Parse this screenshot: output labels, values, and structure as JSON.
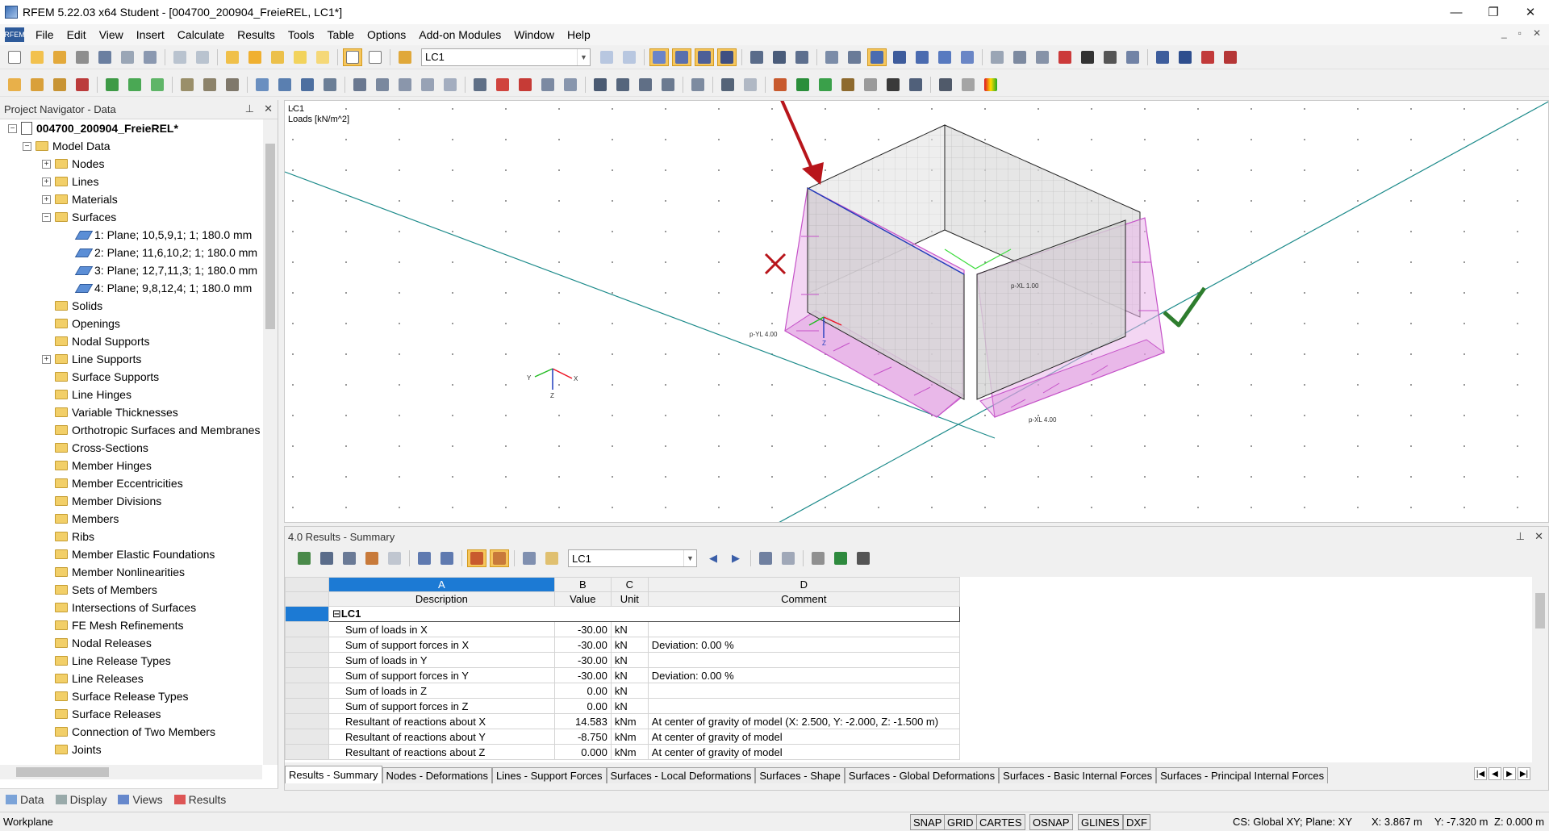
{
  "window": {
    "title": "RFEM 5.22.03 x64 Student - [004700_200904_FreieREL, LC1*]",
    "controls": [
      "—",
      "❐",
      "✕"
    ]
  },
  "menu": {
    "logo": "RFEM",
    "items": [
      "File",
      "Edit",
      "View",
      "Insert",
      "Calculate",
      "Results",
      "Tools",
      "Table",
      "Options",
      "Add-on Modules",
      "Window",
      "Help"
    ],
    "mdi_controls": [
      "_",
      "▫",
      "✕"
    ]
  },
  "toolbar": {
    "load_case": "LC1"
  },
  "navigator": {
    "title": "Project Navigator - Data",
    "project": "004700_200904_FreieREL*",
    "model_data": "Model Data",
    "items": {
      "nodes": "Nodes",
      "lines": "Lines",
      "materials": "Materials",
      "surfaces": "Surfaces",
      "surface_1": "1: Plane; 10,5,9,1; 1; 180.0 mm",
      "surface_2": "2: Plane; 11,6,10,2; 1; 180.0 mm",
      "surface_3": "3: Plane; 12,7,11,3; 1; 180.0 mm",
      "surface_4": "4: Plane; 9,8,12,4; 1; 180.0 mm",
      "solids": "Solids",
      "openings": "Openings",
      "nodal_supports": "Nodal Supports",
      "line_supports": "Line Supports",
      "surface_supports": "Surface Supports",
      "line_hinges": "Line Hinges",
      "variable_thicknesses": "Variable Thicknesses",
      "orthotropic": "Orthotropic Surfaces and Membranes",
      "cross_sections": "Cross-Sections",
      "member_hinges": "Member Hinges",
      "member_eccentricities": "Member Eccentricities",
      "member_divisions": "Member Divisions",
      "members": "Members",
      "ribs": "Ribs",
      "member_elastic_foundations": "Member Elastic Foundations",
      "member_nonlinearities": "Member Nonlinearities",
      "sets_of_members": "Sets of Members",
      "intersections": "Intersections of Surfaces",
      "fe_mesh": "FE Mesh Refinements",
      "nodal_releases": "Nodal Releases",
      "line_release_types": "Line Release Types",
      "line_releases": "Line Releases",
      "surface_release_types": "Surface Release Types",
      "surface_releases": "Surface Releases",
      "connection_two_members": "Connection of Two Members",
      "joints": "Joints"
    },
    "tabs": [
      "Data",
      "Display",
      "Views",
      "Results"
    ]
  },
  "view": {
    "lc": "LC1",
    "loads_label": "Loads [kN/m^2]",
    "load_labels": {
      "pyl": "p-YL 4.00",
      "pxl_top": "p-XL 1.00",
      "pxl_bottom": "p-XL 4.00"
    },
    "axes": {
      "x": "X",
      "y": "Y",
      "z": "Z"
    },
    "colors": {
      "load": "#c552c8",
      "load_fill": "#e9b5ea",
      "arrow": "#b8151b",
      "check": "#2e7d2e",
      "axis_line": "#1b8a8a"
    }
  },
  "results": {
    "title": "4.0 Results - Summary",
    "load_case": "LC1",
    "columns": {
      "A": "A",
      "B": "B",
      "C": "C",
      "D": "D"
    },
    "headers": {
      "description": "Description",
      "value": "Value",
      "unit": "Unit",
      "comment": "Comment"
    },
    "group": "LC1",
    "rows": [
      {
        "description": "Sum of loads in X",
        "value": "-30.00",
        "unit": "kN",
        "comment": ""
      },
      {
        "description": "Sum of support forces in X",
        "value": "-30.00",
        "unit": "kN",
        "comment": "Deviation:  0.00 %"
      },
      {
        "description": "Sum of loads in Y",
        "value": "-30.00",
        "unit": "kN",
        "comment": ""
      },
      {
        "description": "Sum of support forces in Y",
        "value": "-30.00",
        "unit": "kN",
        "comment": "Deviation:  0.00 %"
      },
      {
        "description": "Sum of loads in Z",
        "value": "0.00",
        "unit": "kN",
        "comment": ""
      },
      {
        "description": "Sum of support forces in Z",
        "value": "0.00",
        "unit": "kN",
        "comment": ""
      },
      {
        "description": "Resultant of reactions about X",
        "value": "14.583",
        "unit": "kNm",
        "comment": "At center of gravity of model (X: 2.500, Y: -2.000, Z: -1.500 m)"
      },
      {
        "description": "Resultant of reactions about Y",
        "value": "-8.750",
        "unit": "kNm",
        "comment": "At center of gravity of model"
      },
      {
        "description": "Resultant of reactions about Z",
        "value": "0.000",
        "unit": "kNm",
        "comment": "At center of gravity of model"
      }
    ],
    "tabs": [
      "Results - Summary",
      "Nodes - Deformations",
      "Lines - Support Forces",
      "Surfaces - Local Deformations",
      "Surfaces - Shape",
      "Surfaces - Global Deformations",
      "Surfaces - Basic Internal Forces",
      "Surfaces - Principal Internal Forces"
    ]
  },
  "status": {
    "workplane": "Workplane",
    "toggles": [
      "SNAP",
      "GRID",
      "CARTES",
      "OSNAP",
      "GLINES",
      "DXF"
    ],
    "cs": "CS: Global XY; Plane: XY",
    "x": "X:  3.867 m",
    "y": "Y:  -7.320 m",
    "z": "Z:  0.000 m"
  }
}
